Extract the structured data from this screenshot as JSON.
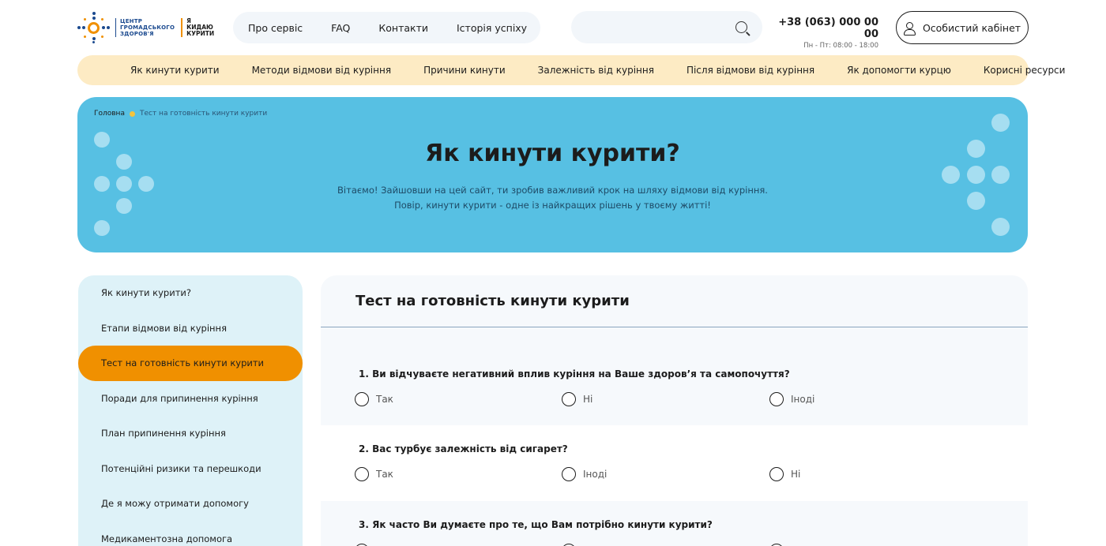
{
  "header": {
    "logo_org": [
      "ЦЕНТР",
      "ГРОМАДСЬКОГО",
      "ЗДОРОВ'Я"
    ],
    "logo_program": [
      "Я",
      "КИДАЮ",
      "КУРИТИ"
    ],
    "topnav": [
      "Про сервіс",
      "FAQ",
      "Контакти",
      "Історія успіху"
    ],
    "search_placeholder": "",
    "phone": "+38 (063) 000 00 00",
    "hours": "Пн - Пт: 08:00 - 18:00",
    "cabinet_label": "Особистий кабінет"
  },
  "catnav": [
    "Як кинути курити",
    "Методи відмови від куріння",
    "Причини кинути",
    "Залежність від куріння",
    "Після відмови від куріння",
    "Як допомогти курцю",
    "Корисні ресурси"
  ],
  "hero": {
    "breadcrumb_home": "Головна",
    "breadcrumb_current": "Тест на готовність кинути курити",
    "title": "Як кинути курити?",
    "subtitle_line1": "Вітаємо! Зайшовши на цей сайт, ти зробив важливий крок на шляху відмови від куріння.",
    "subtitle_line2": "Повір, кинути курити - одне із найкращих рішень у твоєму житті!"
  },
  "sidebar": {
    "items": [
      "Як кинути курити?",
      "Етапи відмови від куріння",
      "Тест на готовність кинути курити",
      "Поради для припинення куріння",
      "План припинення куріння",
      "Потенційні ризики та перешкоди",
      "Де я можу отримати допомогу",
      "Медикаментозна допомога"
    ],
    "active_index": 2
  },
  "test": {
    "title": "Тест на готовність кинути курити",
    "questions": [
      {
        "text": "1. Ви відчуваєте негативний вплив куріння на Ваше здоров’я та самопочуття?",
        "options": [
          "Так",
          "Ні",
          "Іноді"
        ]
      },
      {
        "text": "2. Вас турбує залежність від сигарет?",
        "options": [
          "Так",
          "Іноді",
          "Ні"
        ]
      },
      {
        "text": "3. Як часто Ви думаєте про те, що Вам потрібно кинути курити?",
        "options": []
      }
    ]
  },
  "colors": {
    "accent_orange": "#f09000",
    "hero_blue": "#57c0e3",
    "catnav_bg": "#fdebc4",
    "sidebar_bg": "#def2f8"
  }
}
